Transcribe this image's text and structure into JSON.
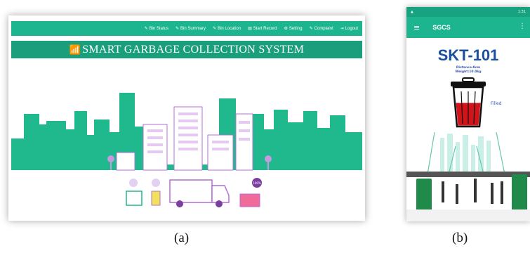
{
  "web": {
    "nav_items": [
      {
        "icon": "pencil-icon",
        "glyph": "✎",
        "label": "Bin Status"
      },
      {
        "icon": "pencil-icon",
        "glyph": "✎",
        "label": "Bin Summary"
      },
      {
        "icon": "pencil-icon",
        "glyph": "✎",
        "label": "Bin Location"
      },
      {
        "icon": "document-icon",
        "glyph": "▤",
        "label": "Start Record"
      },
      {
        "icon": "gear-icon",
        "glyph": "⚙",
        "label": "Setting"
      },
      {
        "icon": "pencil-icon",
        "glyph": "✎",
        "label": "Complaint"
      },
      {
        "icon": "logout-icon",
        "glyph": "⇥",
        "label": "Logout"
      }
    ],
    "title_icon": "wifi-icon",
    "title": "SMART GARBAGE COLLECTION SYSTEM",
    "full_bin_badge": "100%"
  },
  "mobile": {
    "status_time": "1:31",
    "app_title": "SGCS",
    "menu_icon": "hamburger-menu-icon",
    "overflow_icon": "more-vert-icon",
    "device_id": "SKT-101",
    "distance_label": "Distance:8cm",
    "weight_label": "Weight:10.0kg",
    "fill_status": "Filled",
    "bin_fill_percent": 60
  },
  "captions": {
    "a": "(a)",
    "b": "(b)"
  },
  "colors": {
    "accent": "#1db58f",
    "accent_dark": "#1a9e7b",
    "city_green": "#20b98e",
    "violet": "#b36fd6",
    "bin_red": "#d0141a"
  }
}
